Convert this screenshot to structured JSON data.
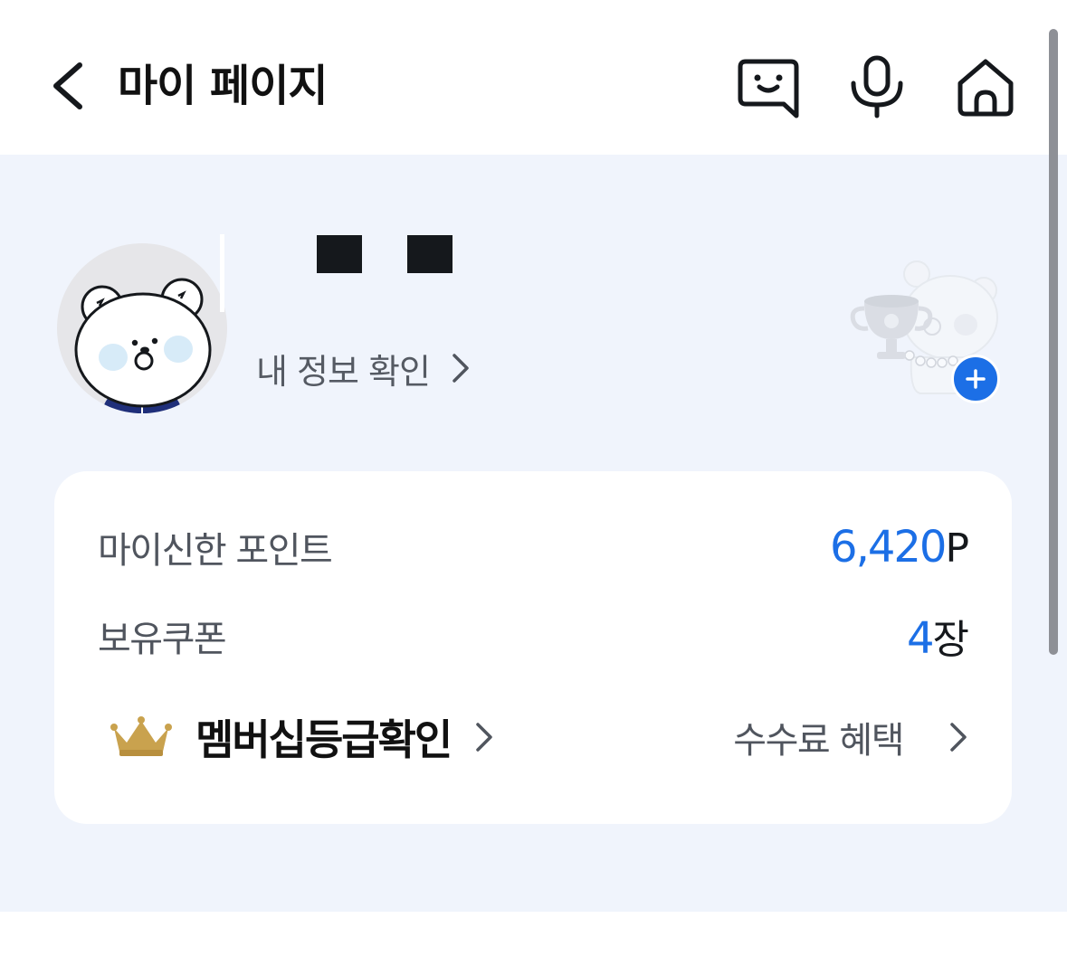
{
  "header": {
    "title": "마이 페이지",
    "back_icon": "chevron-left-icon",
    "actions": [
      {
        "name": "chatbot",
        "icon": "chat-face-icon"
      },
      {
        "name": "voice",
        "icon": "microphone-icon"
      },
      {
        "name": "home",
        "icon": "home-icon"
      }
    ]
  },
  "profile": {
    "avatar_icon": "bear-avatar-icon",
    "my_info_label": "내 정보 확인",
    "badge_icon": "trophy-bear-icon",
    "add_icon": "plus-icon"
  },
  "card": {
    "points": {
      "label": "마이신한 포인트",
      "value": "6,420",
      "unit": "P"
    },
    "coupons": {
      "label": "보유쿠폰",
      "value": "4",
      "unit": "장"
    },
    "membership": {
      "crown_icon": "crown-icon",
      "label": "멤버십등급확인"
    },
    "fee_benefit": {
      "label": "수수료 혜택"
    }
  },
  "colors": {
    "accent": "#1c6fe6",
    "profile_bg": "#f0f4fc",
    "crown": "#c9a24e"
  }
}
